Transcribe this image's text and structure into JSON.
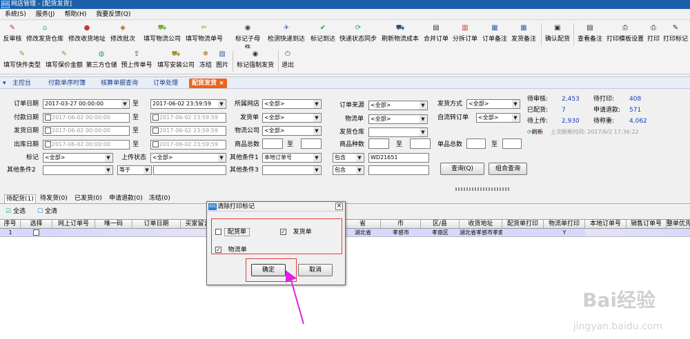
{
  "window": {
    "title": "网店管理 - [配货发货]",
    "logo": "KIS"
  },
  "menu": [
    "系统(S)",
    "服务(J)",
    "帮助(H)",
    "我要反馈(Q)"
  ],
  "toolbar1": [
    "反审核",
    "修改发货仓库",
    "修改收货地址",
    "修改批次",
    "填写物流公司",
    "填写物流单号",
    "标记子母件",
    "检测快递到达",
    "标记到达",
    "快递状态同步",
    "刷新物流成本",
    "合并订单",
    "分拆订单",
    "订单备注",
    "发货备注",
    "确认配货",
    "查看备注",
    "打印模板设置",
    "打印",
    "打印标记"
  ],
  "toolbar2": [
    "填写快件类型",
    "填写保价金额",
    "第三方仓储",
    "预上传单号",
    "填写安装公司",
    "冻结",
    "图片",
    "标记强制发货",
    "退出"
  ],
  "nav": {
    "tabs": [
      "主控台",
      "付款单序时簿",
      "核算单据查询",
      "订单处理",
      "配货发货"
    ],
    "close": "×"
  },
  "filters": {
    "order_date": {
      "label": "订单日期",
      "from": "2017-03-27 00:00:00",
      "to": "2017-06-02 23:59:59"
    },
    "pay_date": {
      "label": "付款日期",
      "from": "2017-06-02 00:00:00",
      "to": "2017-06-02 23:59:59"
    },
    "ship_date": {
      "label": "发货日期",
      "from": "2017-06-02 00:00:00",
      "to": "2017-06-02 23:59:59"
    },
    "out_date": {
      "label": "出库日期",
      "from": "2017-06-02 00:00:00",
      "to": "2017-06-02 23:59:59"
    },
    "to_label": "至",
    "shop": {
      "label": "所属网店",
      "value": "<全部>"
    },
    "ship_no": {
      "label": "发货单",
      "value": "<全部>"
    },
    "logistics_co": {
      "label": "物流公司",
      "value": "<全部>"
    },
    "item_total": {
      "label": "商品总数",
      "to": "至"
    },
    "order_source": {
      "label": "订单来源",
      "value": "<全部>"
    },
    "logistics_no": {
      "label": "物流单",
      "value": "<全部>"
    },
    "ship_warehouse": {
      "label": "发货仓库",
      "value": ""
    },
    "item_kinds": {
      "label": "商品种数",
      "to": "至"
    },
    "ship_method": {
      "label": "发货方式",
      "value": "<全部>"
    },
    "auto_transfer": {
      "label": "自流转订单",
      "value": "<全部>"
    },
    "single_total": {
      "label": "单品总数",
      "to": "至"
    },
    "mark": {
      "label": "标记",
      "value": "<全部>"
    },
    "upload_status": {
      "label": "上传状态",
      "value": "<全部>"
    },
    "other1": {
      "label": "其他条件1",
      "field": "本地订单号",
      "op": "包含",
      "value": "WD21651"
    },
    "other2": {
      "label": "其他条件2",
      "op": "等于",
      "value": ""
    },
    "other3": {
      "label": "其他条件3",
      "op": "包含",
      "value": ""
    },
    "query_btn": "查询(Q)",
    "combo_query_btn": "组合查询"
  },
  "stats": {
    "pending_review_label": "待审核:",
    "pending_review": "2,453",
    "pending_print_label": "待打印:",
    "pending_print": "408",
    "allocated_label": "已配货:",
    "allocated": "7",
    "refund_req_label": "申请退款:",
    "refund_req": "571",
    "uploaded_label": "待上传:",
    "uploaded": "2,930",
    "weigh_label": "待称重:",
    "weigh": "4,062",
    "refresh": "刷新",
    "last_refresh": "上次刷新时间: 2017/6/2 17:36:22"
  },
  "subtabs": [
    "待配货(1)",
    "待发货(0)",
    "已发货(0)",
    "申请退款(0)",
    "冻结(0)"
  ],
  "select_all": "全选",
  "clear_all": "全清",
  "grid": {
    "headers": [
      "序号",
      "选择",
      "网上订单号",
      "唯一码",
      "订单日期",
      "买家留言",
      "省",
      "市",
      "区/县",
      "收货地址",
      "配货单打印",
      "物流单打印",
      "本地订单号",
      "销售订单号",
      "整单优先"
    ],
    "row": {
      "seq": "1",
      "province": "湖北省",
      "city": "孝感市",
      "district": "孝南区",
      "address": "湖北省孝感市孝南",
      "logistics_print": "Y"
    }
  },
  "dialog": {
    "title": "清除打印标记",
    "opt_alloc": "配货单",
    "opt_ship": "发货单",
    "opt_logistics": "物流单",
    "ok": "确定",
    "cancel": "取消"
  },
  "watermark": {
    "brand": "Bai经验",
    "url": "jingyan.baidu.com"
  }
}
